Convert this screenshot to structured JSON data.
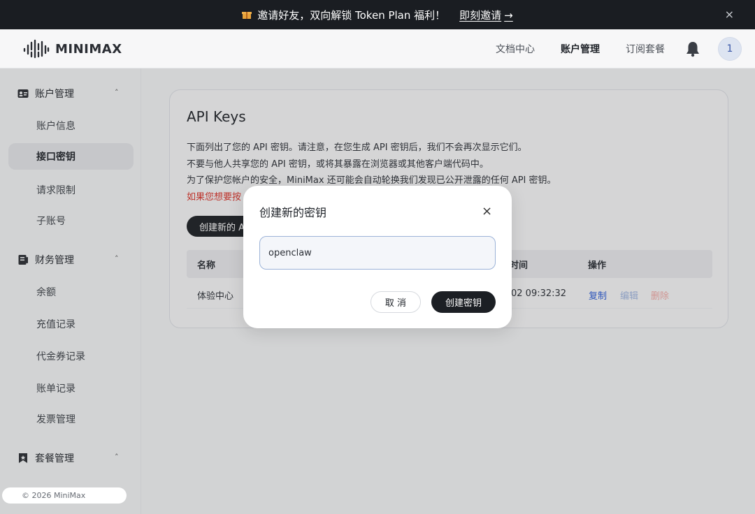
{
  "banner": {
    "gift_icon": "gift-icon",
    "text": "邀请好友，双向解锁 Token Plan 福利！",
    "link_text": "即刻邀请",
    "arrow": "→",
    "close": "×"
  },
  "header": {
    "logo_text": "MINIMAX",
    "nav": {
      "docs": "文档中心",
      "account": "账户管理",
      "subscription": "订阅套餐"
    },
    "avatar": "1"
  },
  "sidebar": {
    "groups": [
      {
        "label": "账户管理",
        "icon": "id-card-icon",
        "caret": "˄"
      },
      {
        "label": "财务管理",
        "icon": "ledger-icon",
        "caret": "˄"
      },
      {
        "label": "套餐管理",
        "icon": "bookmark-icon",
        "caret": "˄"
      }
    ],
    "items": {
      "account_info": "账户信息",
      "api_keys": "接口密钥",
      "rate_limits": "请求限制",
      "sub_accounts": "子账号",
      "balance": "余额",
      "recharge": "充值记录",
      "vouchers": "代金券记录",
      "bills": "账单记录",
      "invoices": "发票管理"
    },
    "footer": "© 2026 MiniMax"
  },
  "main": {
    "title": "API Keys",
    "desc1": "下面列出了您的 API 密钥。请注意，在您生成 API 密钥后，我们不会再次显示它们。",
    "desc2": "不要与他人共享您的 API 密钥，或将其暴露在浏览器或其他客户端代码中。",
    "desc3": "为了保护您帐户的安全，MiniMax 还可能会自动轮换我们发现已公开泄露的任何 API 密钥。",
    "warn": "如果您想要按",
    "create_button": "创建新的 A",
    "table": {
      "headers": {
        "name": "名称",
        "time": "时间",
        "ops": "操作"
      },
      "row": {
        "name": "体验中心",
        "time": "02 09:32:32",
        "copy": "复制",
        "edit": "编辑",
        "delete": "删除"
      }
    }
  },
  "modal": {
    "title": "创建新的密钥",
    "close": "×",
    "input_value": "openclaw",
    "cancel": "取 消",
    "confirm": "创建密钥"
  },
  "colors": {
    "primary": "#1c1f24",
    "warning": "#d93026",
    "link": "#2a5bd7",
    "banner_bg": "#1a1d22",
    "input_border": "#9cb3d8"
  }
}
